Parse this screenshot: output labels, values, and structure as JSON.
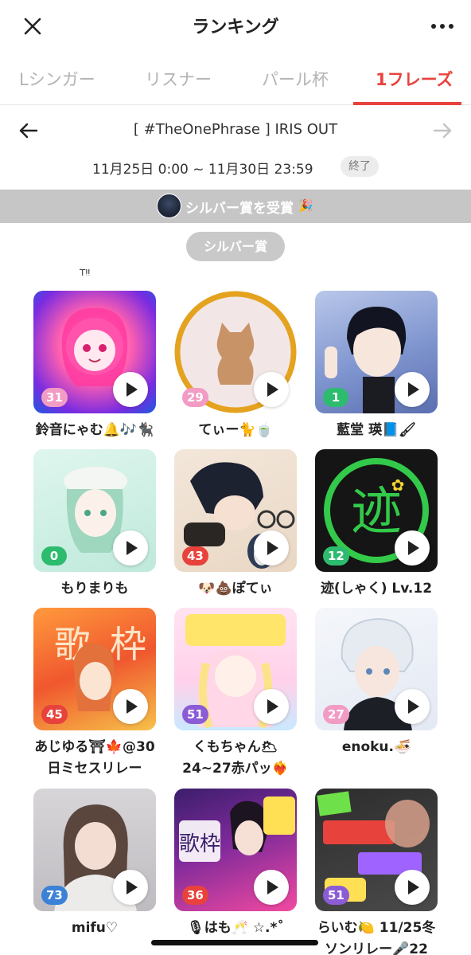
{
  "header": {
    "title": "ランキング"
  },
  "tabs": [
    {
      "label": "Lシンガー"
    },
    {
      "label": "リスナー"
    },
    {
      "label": "パール杯"
    },
    {
      "label": "1フレーズ",
      "active": true
    }
  ],
  "phrase": {
    "title": "[ #TheOnePhrase ] IRIS OUT",
    "period": "11月25日 0:00 ~ 11月30日 23:59",
    "status": "終了"
  },
  "banner": {
    "text": "シルバー賞を受賞",
    "emoji": "🎉"
  },
  "award_label": "シルバー賞",
  "cut_text": "T‼",
  "colors": {
    "accent": "#e8423c",
    "rank_pink": "#f29bc4",
    "rank_green": "#2dbb6e",
    "rank_red": "#e8423c",
    "rank_purple": "#8b5cd6",
    "rank_blue": "#3b82d6"
  },
  "entries": [
    {
      "rank": "31",
      "name": "鈴音にゃむ🔔🎶🐈‍⬛",
      "rank_color": "#f29bc4"
    },
    {
      "rank": "29",
      "name": "てぃー🐈🍵",
      "rank_color": "#f29bc4"
    },
    {
      "rank": "1",
      "name": "藍堂 瑛📘🖌",
      "rank_color": "#2dbb6e"
    },
    {
      "rank": "0",
      "name": "もりまりも",
      "rank_color": "#2dbb6e"
    },
    {
      "rank": "43",
      "name": "🐶💩ぽてぃ",
      "rank_color": "#e8423c"
    },
    {
      "rank": "12",
      "name": "迹(しゃく) Lv.12",
      "rank_color": "#2dbb6e"
    },
    {
      "rank": "45",
      "name": "あじゆる⛩🍁@30\n日ミセスリレー",
      "rank_color": "#e8423c"
    },
    {
      "rank": "51",
      "name": "くもちゃん🌥\n24~27赤パッ❤‍🔥",
      "rank_color": "#8b5cd6"
    },
    {
      "rank": "27",
      "name": "enoku.🍜",
      "rank_color": "#f29bc4"
    },
    {
      "rank": "73",
      "name": "mifu♡",
      "rank_color": "#3b82d6"
    },
    {
      "rank": "36",
      "name": "🎙はも🥂 ☆.*˚",
      "rank_color": "#e8423c"
    },
    {
      "rank": "51",
      "name": "らいむ🍋 11/25冬\nソンリレー🎤22",
      "rank_color": "#8b5cd6"
    }
  ]
}
